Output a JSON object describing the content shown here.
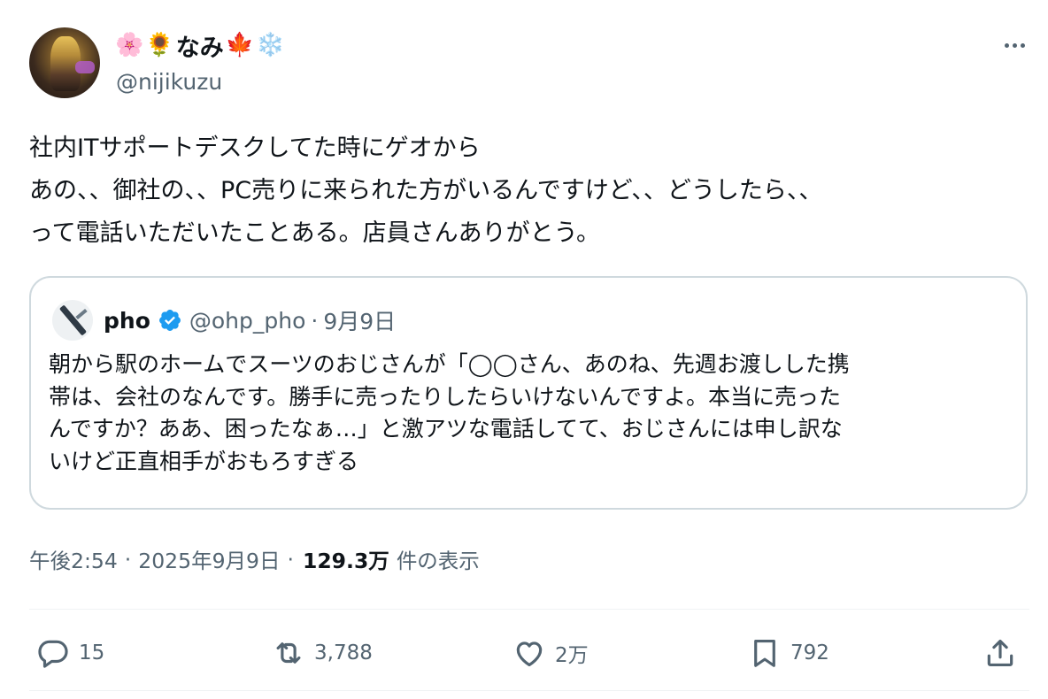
{
  "author": {
    "display_name_text": "なみ",
    "emojis_before": [
      "🌸",
      "🌻"
    ],
    "emojis_after": [
      "🍁",
      "❄️"
    ],
    "handle": "@nijikuzu",
    "avatar_icon": "avatar-photo"
  },
  "more_icon": "more-horizontal-icon",
  "tweet": {
    "text": "社内ITサポートデスクしてた時にゲオから\nあの、、御社の、、PC売りに来られた方がいるんですけど、、どうしたら、、\nって電話いただいたことある。店員さんありがとう。"
  },
  "quote": {
    "name": "pho",
    "handle": "@ohp_pho",
    "separator": "·",
    "date": "9月9日",
    "verified_icon": "verified-badge-icon",
    "verified_color": "#1d9bf0",
    "text": "朝から駅のホームでスーツのおじさんが「◯◯さん、あのね、先週お渡しした携\n帯は、会社のなんです。勝手に売ったりしたらいけないんですよ。本当に売った\nんですか？ああ、困ったなぁ…」と激アツな電話してて、おじさんには申し訳な\nいけど正直相手がおもろすぎる"
  },
  "meta": {
    "time": "午後2:54",
    "separator": "·",
    "date": "2025年9月9日",
    "views": "129.3万",
    "views_label": "件の表示"
  },
  "actions": {
    "reply": {
      "icon": "reply-icon",
      "count": "15"
    },
    "retweet": {
      "icon": "retweet-icon",
      "count": "3,788"
    },
    "like": {
      "icon": "heart-icon",
      "count": "2万"
    },
    "bookmark": {
      "icon": "bookmark-icon",
      "count": "792"
    },
    "share": {
      "icon": "share-icon"
    }
  },
  "colors": {
    "text": "#0f1419",
    "secondary": "#536471",
    "border": "#cfd9de",
    "divider": "#eff3f4"
  }
}
